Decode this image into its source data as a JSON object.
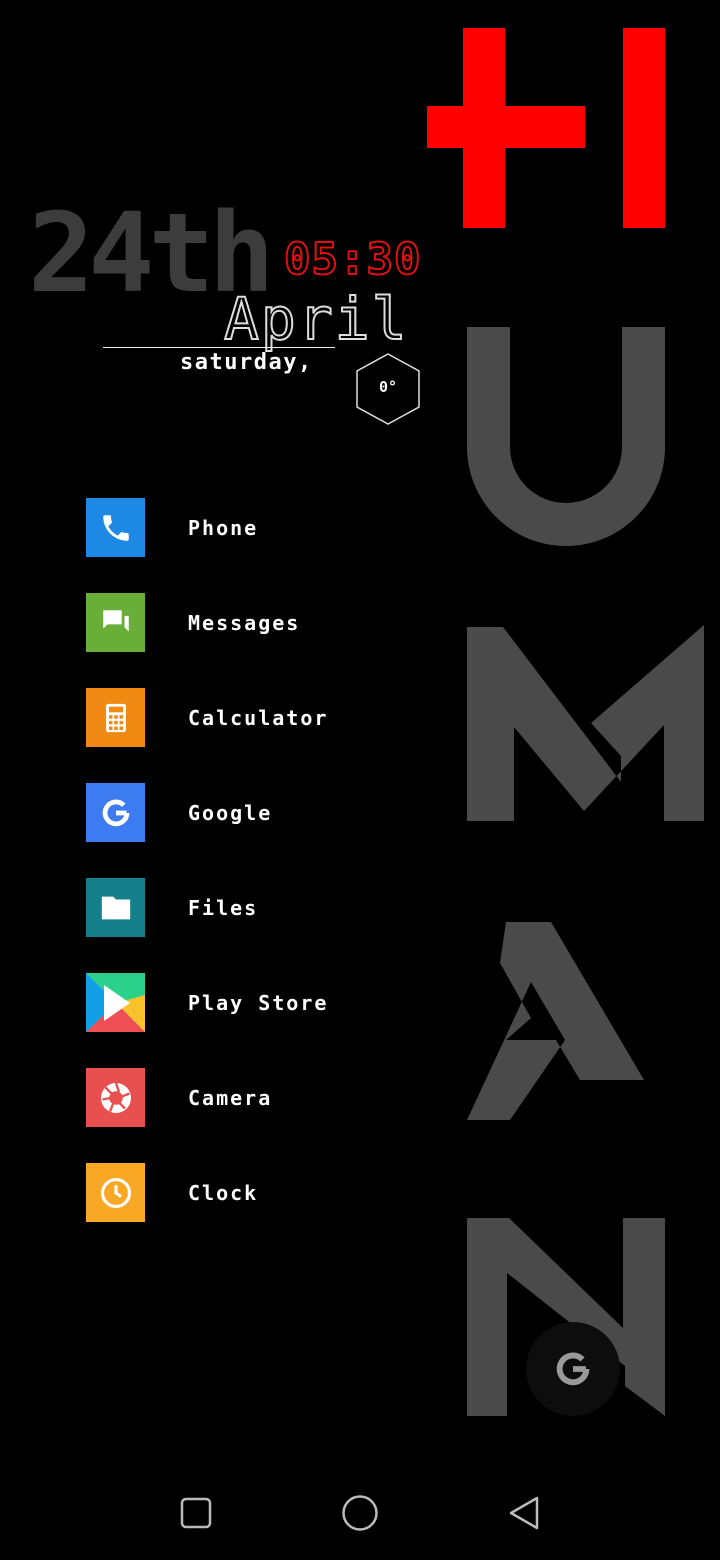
{
  "wallpaper": {
    "letters": [
      "U",
      "M",
      "A",
      "N"
    ],
    "accent_color": "#ff0000",
    "letter_color": "#4a4a4a"
  },
  "widget": {
    "date_big": "24th",
    "time": "05:30",
    "month": "April",
    "weekday": "saturday,",
    "temperature": "0°",
    "time_color": "#e01010"
  },
  "apps": [
    {
      "label": "Phone",
      "icon": "phone-icon",
      "color": "#1e88e5"
    },
    {
      "label": "Messages",
      "icon": "messages-icon",
      "color": "#6aae3a"
    },
    {
      "label": "Calculator",
      "icon": "calculator-icon",
      "color": "#f08a12"
    },
    {
      "label": "Google",
      "icon": "google-icon",
      "color": "#3c7cf0"
    },
    {
      "label": "Files",
      "icon": "folder-icon",
      "color": "#157f8c"
    },
    {
      "label": "Play Store",
      "icon": "play-store-icon",
      "color": "#1e88e5"
    },
    {
      "label": "Camera",
      "icon": "camera-icon",
      "color": "#e85050"
    },
    {
      "label": "Clock",
      "icon": "clock-icon",
      "color": "#f9a825"
    }
  ],
  "fab": {
    "icon": "google-search-icon"
  },
  "navbar": {
    "recents_icon": "square-icon",
    "home_icon": "circle-icon",
    "back_icon": "triangle-back-icon"
  }
}
